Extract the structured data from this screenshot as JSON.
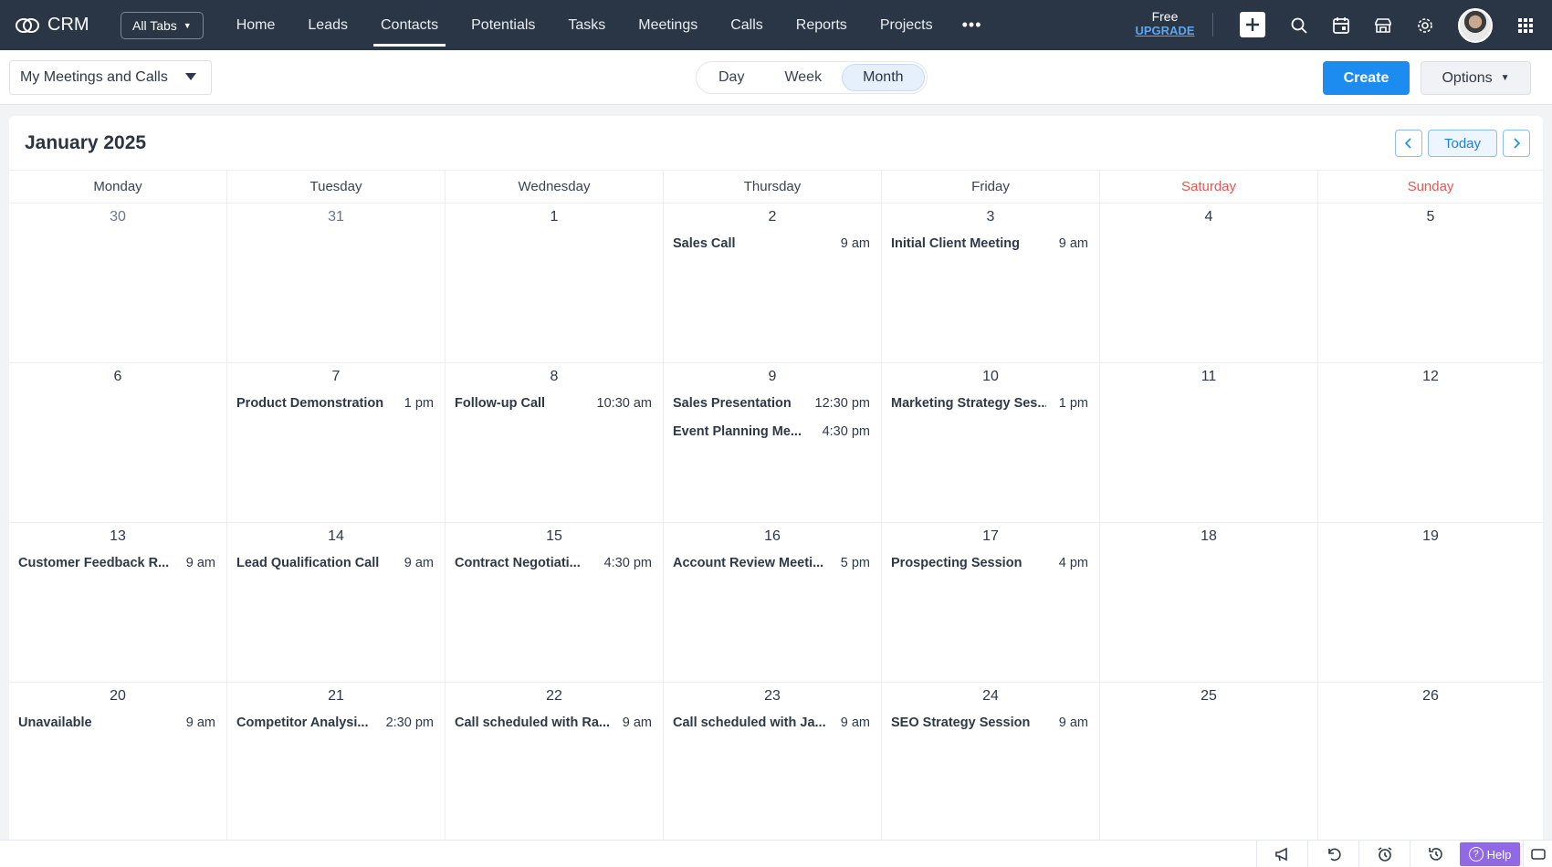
{
  "app": {
    "name": "CRM"
  },
  "topnav": {
    "all_tabs_label": "All Tabs",
    "links": [
      {
        "label": "Home",
        "active": false
      },
      {
        "label": "Leads",
        "active": false
      },
      {
        "label": "Contacts",
        "active": true
      },
      {
        "label": "Potentials",
        "active": false
      },
      {
        "label": "Tasks",
        "active": false
      },
      {
        "label": "Meetings",
        "active": false
      },
      {
        "label": "Calls",
        "active": false
      },
      {
        "label": "Reports",
        "active": false
      },
      {
        "label": "Projects",
        "active": false
      }
    ],
    "more_label": "•••",
    "plan_label": "Free",
    "upgrade_label": "UPGRADE",
    "icons": [
      "plus-icon",
      "search-icon",
      "calendar-icon",
      "store-icon",
      "gear-icon",
      "avatar",
      "apps-grid-icon"
    ]
  },
  "toolbar": {
    "view_select_value": "My Meetings and Calls",
    "modes": [
      {
        "label": "Day",
        "active": false
      },
      {
        "label": "Week",
        "active": false
      },
      {
        "label": "Month",
        "active": true
      }
    ],
    "create_label": "Create",
    "options_label": "Options"
  },
  "calendar": {
    "title": "January 2025",
    "today_label": "Today",
    "weekdays": [
      {
        "label": "Monday",
        "weekend": false
      },
      {
        "label": "Tuesday",
        "weekend": false
      },
      {
        "label": "Wednesday",
        "weekend": false
      },
      {
        "label": "Thursday",
        "weekend": false
      },
      {
        "label": "Friday",
        "weekend": false
      },
      {
        "label": "Saturday",
        "weekend": true
      },
      {
        "label": "Sunday",
        "weekend": true
      }
    ],
    "weekend_color": "#e5584f",
    "days": [
      {
        "num": "30",
        "other": true,
        "events": []
      },
      {
        "num": "31",
        "other": true,
        "events": []
      },
      {
        "num": "1",
        "events": []
      },
      {
        "num": "2",
        "events": [
          {
            "title": "Sales Call",
            "time": "9 am"
          }
        ]
      },
      {
        "num": "3",
        "events": [
          {
            "title": "Initial Client Meeting",
            "time": "9 am"
          }
        ]
      },
      {
        "num": "4",
        "events": []
      },
      {
        "num": "5",
        "events": []
      },
      {
        "num": "6",
        "events": []
      },
      {
        "num": "7",
        "events": [
          {
            "title": "Product Demonstration",
            "time": "1 pm"
          }
        ]
      },
      {
        "num": "8",
        "events": [
          {
            "title": "Follow-up Call",
            "time": "10:30 am"
          }
        ]
      },
      {
        "num": "9",
        "events": [
          {
            "title": "Sales Presentation",
            "time": "12:30 pm"
          },
          {
            "title": "Event Planning Me...",
            "time": "4:30 pm"
          }
        ]
      },
      {
        "num": "10",
        "events": [
          {
            "title": "Marketing Strategy Ses...",
            "time": "1 pm"
          }
        ]
      },
      {
        "num": "11",
        "events": []
      },
      {
        "num": "12",
        "events": []
      },
      {
        "num": "13",
        "events": [
          {
            "title": "Customer Feedback R...",
            "time": "9 am"
          }
        ]
      },
      {
        "num": "14",
        "events": [
          {
            "title": "Lead Qualification Call",
            "time": "9 am"
          }
        ]
      },
      {
        "num": "15",
        "events": [
          {
            "title": "Contract Negotiati...",
            "time": "4:30 pm"
          }
        ]
      },
      {
        "num": "16",
        "events": [
          {
            "title": "Account Review Meeti...",
            "time": "5 pm"
          }
        ]
      },
      {
        "num": "17",
        "events": [
          {
            "title": "Prospecting Session",
            "time": "4 pm"
          }
        ]
      },
      {
        "num": "18",
        "events": []
      },
      {
        "num": "19",
        "events": []
      },
      {
        "num": "20",
        "events": [
          {
            "title": "Unavailable",
            "time": "9 am"
          }
        ]
      },
      {
        "num": "21",
        "events": [
          {
            "title": "Competitor Analysi...",
            "time": "2:30 pm"
          }
        ]
      },
      {
        "num": "22",
        "events": [
          {
            "title": "Call scheduled with Ra...",
            "time": "9 am"
          }
        ]
      },
      {
        "num": "23",
        "events": [
          {
            "title": "Call scheduled with Ja...",
            "time": "9 am"
          }
        ]
      },
      {
        "num": "24",
        "events": [
          {
            "title": "SEO Strategy Session",
            "time": "9 am"
          }
        ]
      },
      {
        "num": "25",
        "events": []
      },
      {
        "num": "26",
        "events": []
      }
    ]
  },
  "bottombar": {
    "icons": [
      "megaphone-icon",
      "undo-icon",
      "alarm-icon",
      "history-icon"
    ],
    "help_label": "Help"
  },
  "colors": {
    "topbar": "#2a3545",
    "accent": "#1d8cf0",
    "help": "#9068e8"
  }
}
